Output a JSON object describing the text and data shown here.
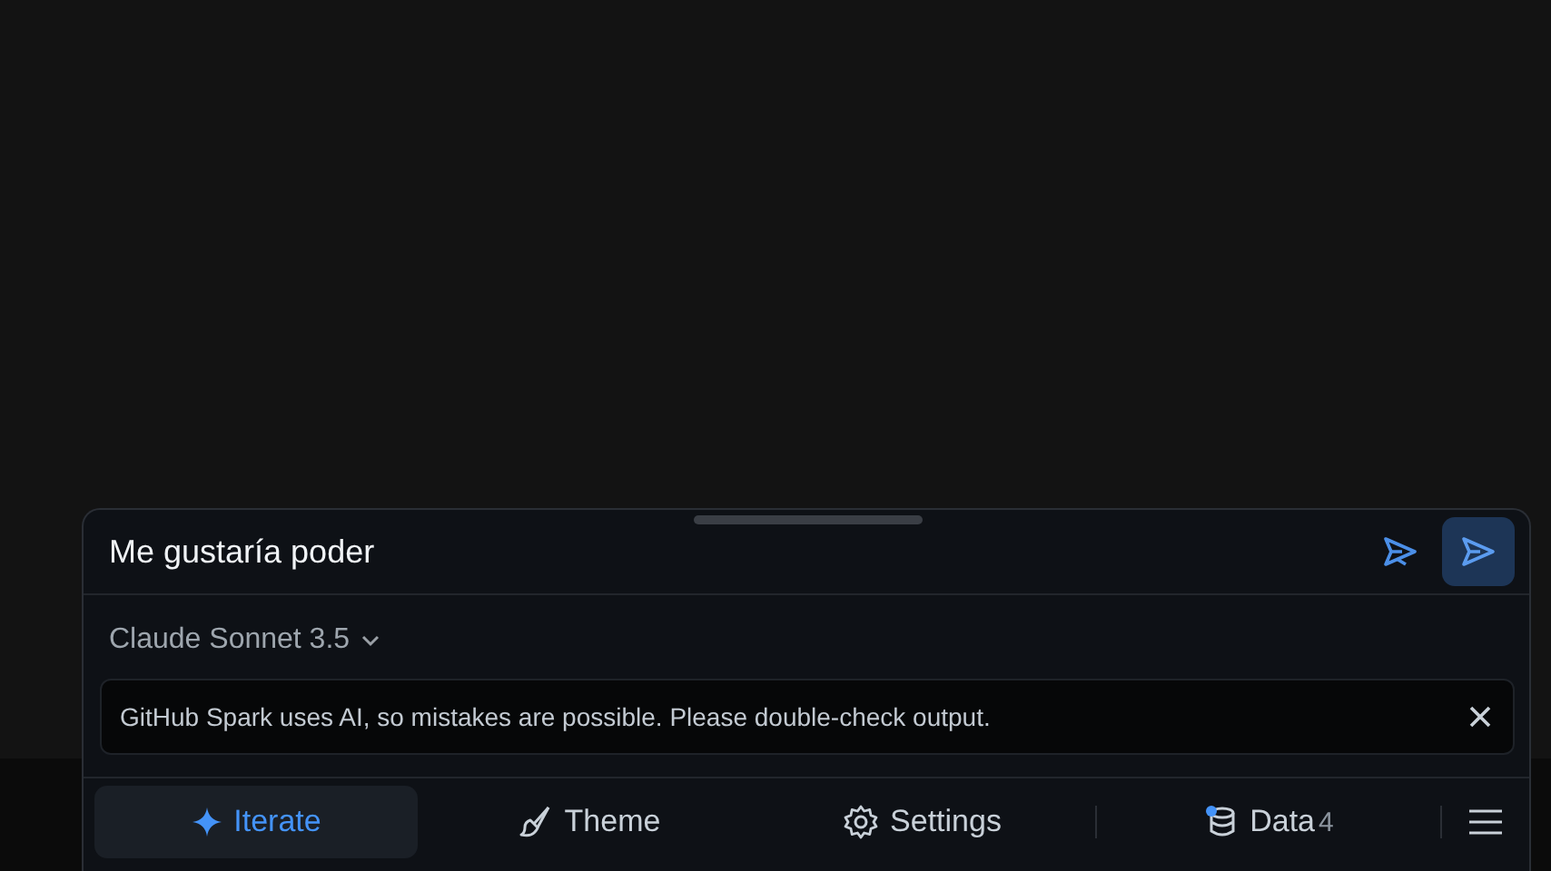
{
  "prompt": {
    "value": "Me gustaría poder "
  },
  "model": {
    "label": "Claude Sonnet 3.5"
  },
  "notice": {
    "text": "GitHub Spark uses AI, so mistakes are possible. Please double-check output."
  },
  "tabs": [
    {
      "label": "Iterate",
      "selected": true
    },
    {
      "label": "Theme",
      "selected": false
    },
    {
      "label": "Settings",
      "selected": false
    },
    {
      "label": "Data",
      "selected": false,
      "count": "4"
    }
  ]
}
